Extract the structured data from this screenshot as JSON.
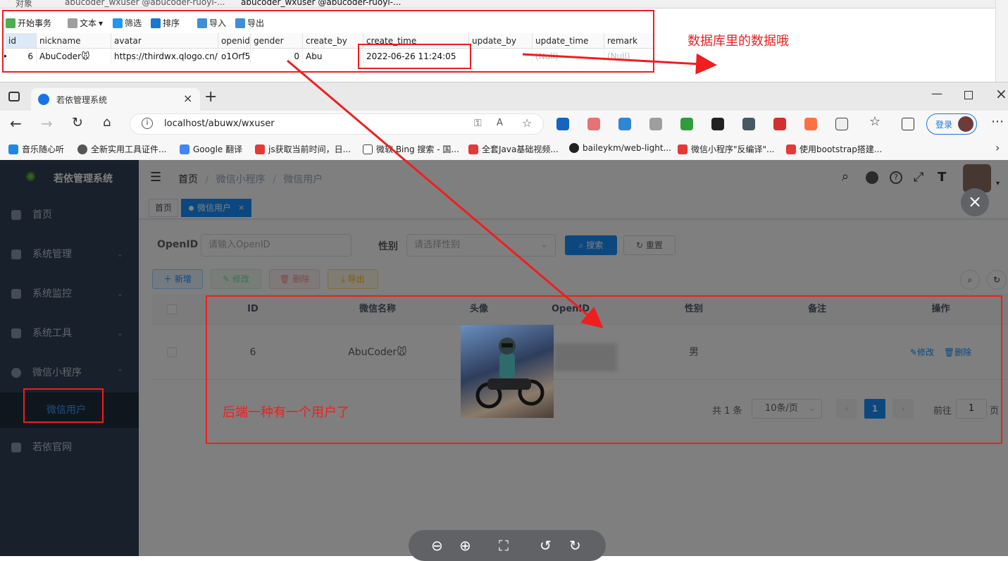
{
  "db_tool": {
    "tabs": [
      "对象",
      "abucoder_wxuser @abucoder-ruoyi-...",
      "abucoder_wxuser @abucoder-ruoyi-..."
    ],
    "toolbar": {
      "begin_tx": "开始事务",
      "text": "文本",
      "filter": "筛选",
      "sort": "排序",
      "import": "导入",
      "export": "导出"
    },
    "columns": [
      "id",
      "nickname",
      "avatar",
      "openid",
      "gender",
      "create_by",
      "create_time",
      "update_by",
      "update_time",
      "remark"
    ],
    "row": {
      "id": "6",
      "nickname": "AbuCoder🐭",
      "avatar": "https://thirdwx.qlogo.cn/r",
      "openid": "o1Orf5\\",
      "gender": "0",
      "create_by": "Abu",
      "create_time": "2022-06-26 11:24:05",
      "update_by": "",
      "update_time": "(Null)",
      "remark": "(Null)"
    }
  },
  "browser": {
    "tab_title": "若依管理系统",
    "url": "localhost/abuwx/wxuser",
    "login_label": "登录",
    "bookmarks": [
      "音乐随心听",
      "全新实用工具证件...",
      "Google 翻译",
      "js获取当前时间，日...",
      "微软 Bing 搜索 - 国...",
      "全套Java基础视频...",
      "baileykm/web-light...",
      "微信小程序\"反编译\"...",
      "使用bootstrap搭建..."
    ]
  },
  "app": {
    "brand": "若依管理系统",
    "sidebar": {
      "items": [
        {
          "label": "首页"
        },
        {
          "label": "系统管理"
        },
        {
          "label": "系统监控"
        },
        {
          "label": "系统工具"
        },
        {
          "label": "微信小程序"
        },
        {
          "label": "微信用户"
        },
        {
          "label": "若依官网"
        }
      ]
    },
    "breadcrumb": [
      "首页",
      "微信小程序",
      "微信用户"
    ],
    "tags": [
      "首页",
      "微信用户"
    ],
    "search": {
      "openid_label": "OpenID",
      "openid_placeholder": "请输入OpenID",
      "gender_label": "性别",
      "gender_placeholder": "请选择性别",
      "search_btn": "搜索",
      "reset_btn": "重置"
    },
    "actions": {
      "add": "新增",
      "edit": "修改",
      "delete": "删除",
      "export": "导出"
    },
    "table": {
      "headers": [
        "ID",
        "微信名称",
        "头像",
        "OpenID",
        "性别",
        "备注",
        "操作"
      ],
      "rows": [
        {
          "id": "6",
          "nickname": "AbuCoder🐭",
          "gender": "男",
          "remark": "",
          "edit": "修改",
          "delete": "删除"
        }
      ]
    },
    "pagination": {
      "total": "共 1 条",
      "page_size": "10条/页",
      "current": "1",
      "goto_label": "前往",
      "goto_value": "1",
      "page_unit": "页"
    }
  },
  "annotations": {
    "db_note": "数据库里的数据哦",
    "ui_note": "后端一种有一个用户了"
  },
  "colors": {
    "accent": "#1890ff",
    "annotation": "#f01e1e",
    "sidebar": "#304156"
  }
}
